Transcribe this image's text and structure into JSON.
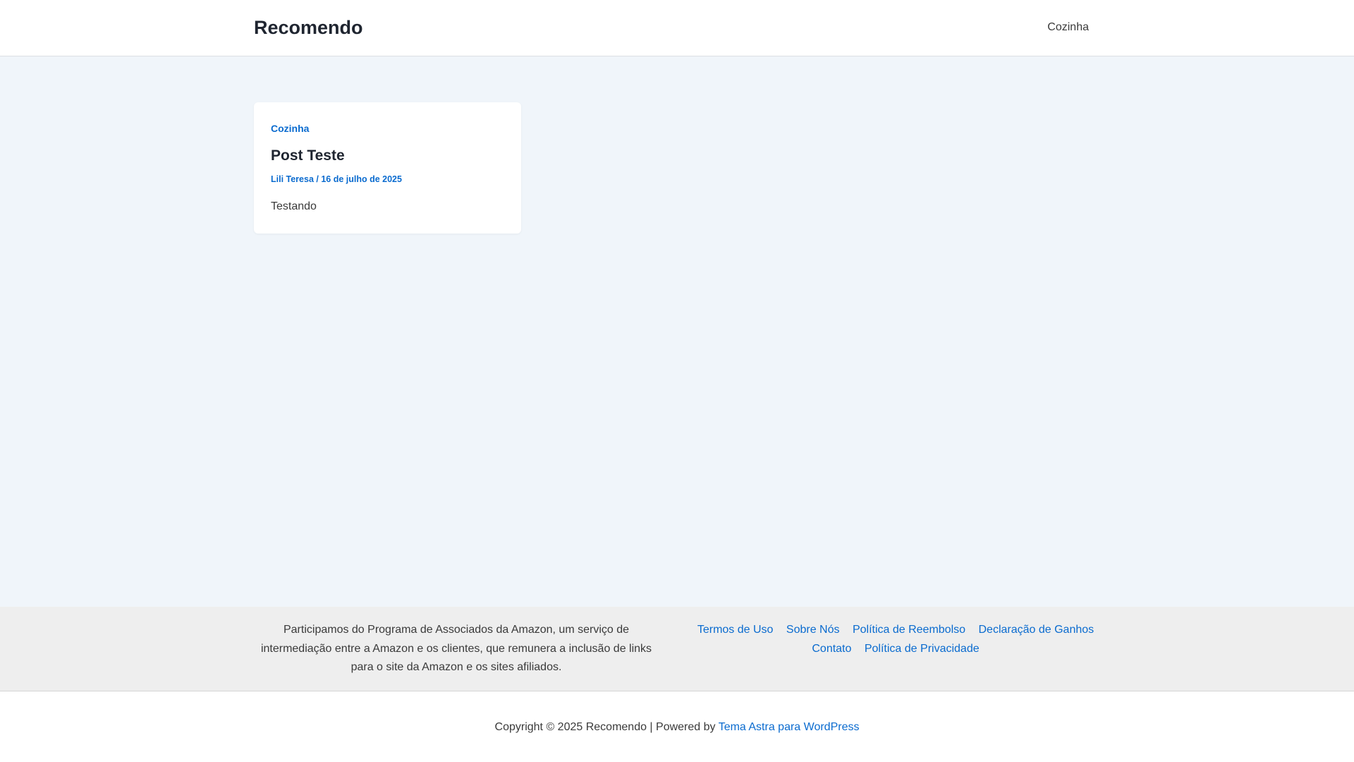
{
  "header": {
    "site_title": "Recomendo",
    "nav": [
      {
        "label": "Cozinha"
      }
    ]
  },
  "post": {
    "category": "Cozinha",
    "title": "Post Teste",
    "meta": "Lili Teresa / 16 de julho de 2025",
    "excerpt": "Testando"
  },
  "footer": {
    "disclosure": "Participamos do Programa de Associados da Amazon, um serviço de intermediação entre a Amazon e os clientes, que remunera a inclusão de links para o site da Amazon e os sites afiliados.",
    "menu": [
      {
        "label": "Termos de Uso"
      },
      {
        "label": "Sobre Nós"
      },
      {
        "label": "Política de Reembolso"
      },
      {
        "label": "Declaração de Ganhos"
      },
      {
        "label": "Contato"
      },
      {
        "label": "Política de Privacidade"
      }
    ],
    "copyright_prefix": "Copyright © 2025 Recomendo | Powered by ",
    "copyright_link": "Tema Astra para WordPress"
  },
  "colors": {
    "accent": "#0a6bcf",
    "page_background": "#f0f5fa",
    "footer_background": "#eeeeee"
  }
}
